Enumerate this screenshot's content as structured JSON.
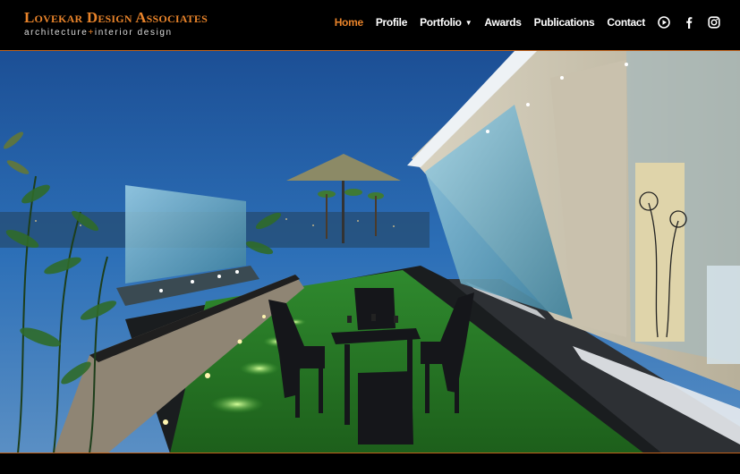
{
  "brand": {
    "name": "Lovekar Design Associates",
    "tagline_left": "architecture",
    "tagline_sep": "+",
    "tagline_right": "interior design"
  },
  "nav": {
    "items": [
      {
        "label": "Home",
        "active": true
      },
      {
        "label": "Profile"
      },
      {
        "label": "Portfolio",
        "dropdown": true
      },
      {
        "label": "Awards"
      },
      {
        "label": "Publications"
      },
      {
        "label": "Contact"
      }
    ],
    "social": [
      "youtube-icon",
      "facebook-icon",
      "instagram-icon"
    ]
  },
  "colors": {
    "accent": "#e8832a",
    "background": "#000000"
  }
}
